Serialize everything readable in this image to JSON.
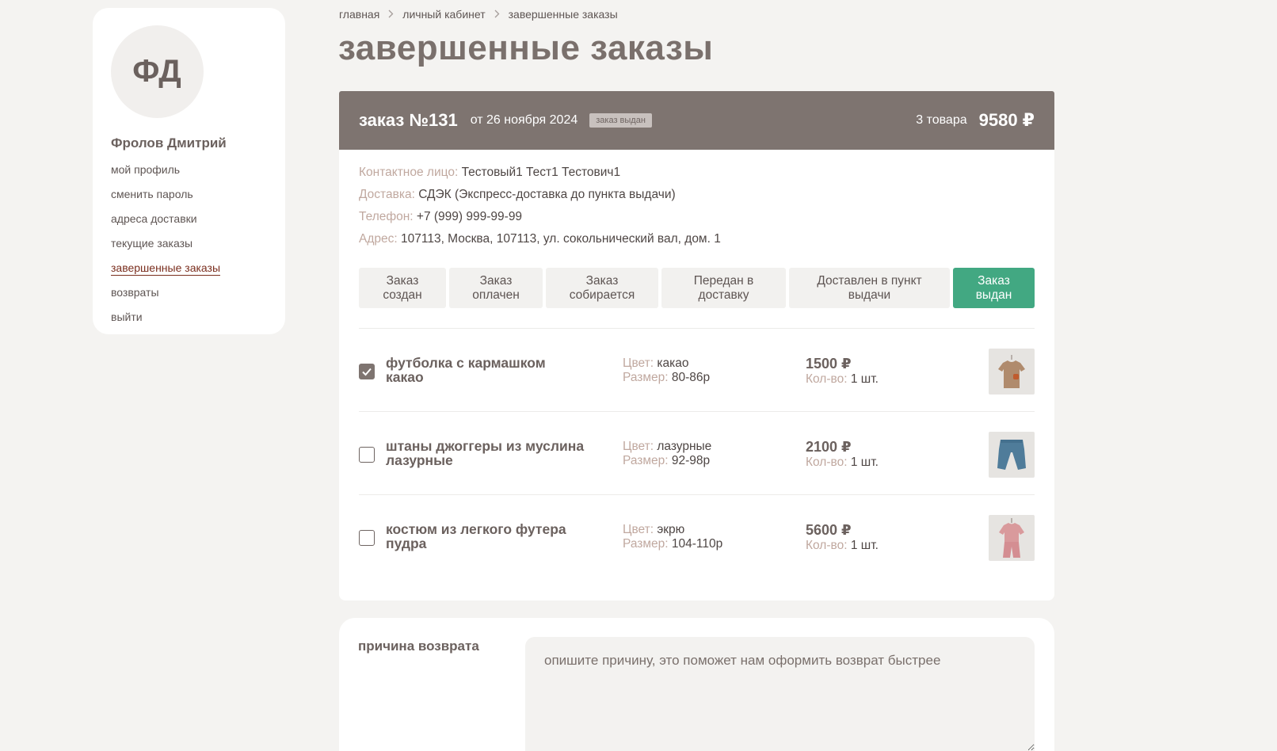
{
  "sidebar": {
    "avatar_initials": "ФД",
    "user_name": "Фролов Дмитрий",
    "nav": [
      {
        "label": "мой профиль"
      },
      {
        "label": "сменить пароль"
      },
      {
        "label": "адреса доставки"
      },
      {
        "label": "текущие заказы"
      },
      {
        "label": "завершенные заказы",
        "active": true
      },
      {
        "label": "возвраты"
      },
      {
        "label": "выйти"
      }
    ]
  },
  "breadcrumb": [
    "главная",
    "личный кабинет",
    "завершенные заказы"
  ],
  "page_title": "завершенные заказы",
  "order": {
    "number": "заказ №131",
    "date": "от 26 ноября 2024",
    "badge": "заказ выдан",
    "count": "3 товара",
    "total": "9580 ₽",
    "info": [
      {
        "label": "Контактное лицо:",
        "value": "Тестовый1 Тест1 Тестович1"
      },
      {
        "label": "Доставка:",
        "value": "СДЭК (Экспресс-доставка до пункта выдачи)"
      },
      {
        "label": "Телефон:",
        "value": "+7 (999) 999-99-99"
      },
      {
        "label": "Адрес:",
        "value": "107113, Москва, 107113, ул. сокольнический вал, дом. 1"
      }
    ],
    "steps": [
      {
        "l1": "Заказ",
        "l2": "создан"
      },
      {
        "l1": "Заказ",
        "l2": "оплачен"
      },
      {
        "l1": "Заказ",
        "l2": "собирается"
      },
      {
        "l1": "Передан в",
        "l2": "доставку"
      },
      {
        "l1": "Доставлен в пункт",
        "l2": "выдачи"
      },
      {
        "l1": "Заказ",
        "l2": "выдан",
        "active": true
      }
    ],
    "color_label": "Цвет:",
    "size_label": "Размер:",
    "qty_label": "Кол-во:",
    "items": [
      {
        "name_l1": "футболка с кармашком",
        "name_l2": "какао",
        "color": "какао",
        "size": "80-86р",
        "price": "1500 ₽",
        "qty": "1 шт.",
        "checked": true,
        "image": "tshirt-thumbnail"
      },
      {
        "name_l1": "штаны джоггеры из муслина",
        "name_l2": "лазурные",
        "color": "лазурные",
        "size": "92-98р",
        "price": "2100 ₽",
        "qty": "1 шт.",
        "checked": false,
        "image": "pants-thumbnail"
      },
      {
        "name_l1": "костюм из легкого футера",
        "name_l2": "пудра",
        "color": "экрю",
        "size": "104-110р",
        "price": "5600 ₽",
        "qty": "1 шт.",
        "checked": false,
        "image": "suit-thumbnail"
      }
    ]
  },
  "return_form": {
    "label": "причина возврата",
    "placeholder": "опишите причину, это поможет нам оформить возврат быстрее"
  },
  "colors": {
    "header_bg": "#7e7470",
    "active_step": "#42a882",
    "active_nav": "#7a2e1e",
    "label_muted": "#c0a89f"
  }
}
